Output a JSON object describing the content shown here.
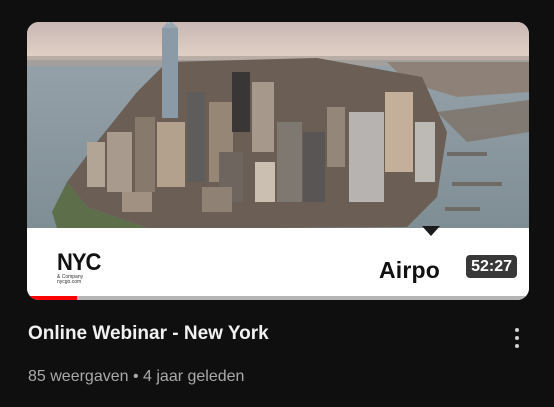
{
  "video": {
    "title": "Online Webinar - New York",
    "views": "85 weergaven",
    "separator": "•",
    "age": "4 jaar geleden",
    "duration": "52:27",
    "watched_fraction": 0.1
  },
  "thumbnail": {
    "logo_text": "NYC",
    "logo_subtext": "& Company nycgo.com",
    "brand_text": "Airpo"
  },
  "icons": {
    "more": "more-vert-icon"
  },
  "colors": {
    "background": "#0f0f0f",
    "title": "#f1f1f1",
    "meta": "#aaaaaa",
    "progress": "#ff0000"
  }
}
